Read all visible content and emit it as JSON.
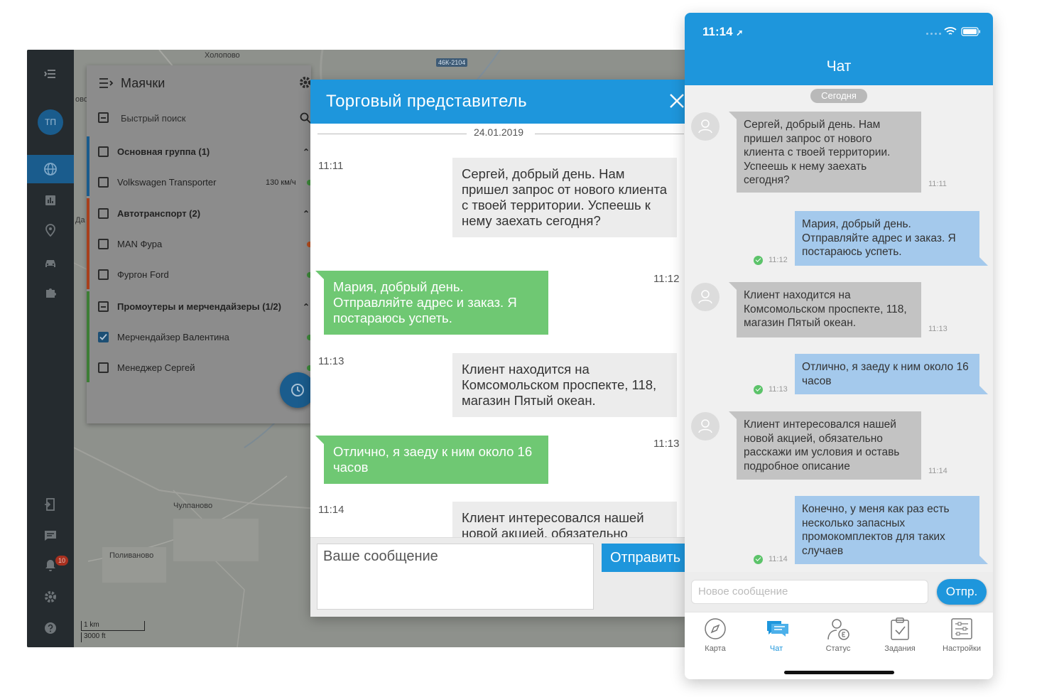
{
  "desktop": {
    "avatar_initials": "ТП",
    "notification_count": "10",
    "map": {
      "labels": [
        "Холопово",
        "Чулпаново",
        "Поливаново",
        "Да",
        "ово"
      ],
      "road_tag": "46К-2104",
      "scale_km": "1 km",
      "scale_ft": "3000 ft"
    },
    "beacons_panel": {
      "title": "Маячки",
      "search_placeholder": "Быстрый поиск",
      "rows": [
        {
          "label": "Основная группа (1)",
          "type": "group",
          "state": "unchecked"
        },
        {
          "label": "Volkswagen Transporter",
          "type": "item",
          "state": "unchecked",
          "speed": "130 км/ч",
          "status_color": "#3d8a3a"
        },
        {
          "label": "Автотранспорт (2)",
          "type": "group",
          "state": "unchecked"
        },
        {
          "label": "MAN Фура",
          "type": "item",
          "state": "unchecked",
          "status_color": "#b54e1f"
        },
        {
          "label": "Фургон Ford",
          "type": "item",
          "state": "unchecked",
          "status_color": "#3d8a3a"
        },
        {
          "label": "Промоутеры и мерчендайзеры (1/2)",
          "type": "group",
          "state": "partial"
        },
        {
          "label": "Мерчендайзер Валентина",
          "type": "item",
          "state": "checked",
          "status_color": "#3d8a3a"
        },
        {
          "label": "Менеджер Сергей",
          "type": "item",
          "state": "unchecked",
          "status_color": "#3d8a3a"
        }
      ]
    },
    "chat_window": {
      "title": "Торговый представитель",
      "date": "24.01.2019",
      "messages": [
        {
          "dir": "in",
          "time": "11:11",
          "text": "Сергей, добрый день. Нам пришел запрос от нового клиента с твоей территории. Успеешь к нему заехать сегодня?"
        },
        {
          "dir": "out",
          "time": "11:12",
          "text": "Мария, добрый день. Отправляйте адрес и заказ. Я постараюсь успеть."
        },
        {
          "dir": "in",
          "time": "11:13",
          "text": "Клиент находится на Комсомольском проспекте, 118, магазин Пятый океан."
        },
        {
          "dir": "out",
          "time": "11:13",
          "text": "Отлично, я заеду к ним около 16 часов"
        },
        {
          "dir": "in",
          "time": "11:14",
          "text": "Клиент интересовался нашей новой акцией, обязательно"
        }
      ],
      "input_placeholder": "Ваше сообщение",
      "send_label": "Отправить"
    }
  },
  "phone": {
    "status_time": "11:14",
    "title": "Чат",
    "day_label": "Сегодня",
    "messages": [
      {
        "dir": "in",
        "time": "11:11",
        "text": "Сергей, добрый день. Нам пришел запрос от нового клиента с твоей территории. Успеешь к нему заехать сегодня?"
      },
      {
        "dir": "out",
        "time": "11:12",
        "text": "Мария, добрый день. Отправляйте адрес и заказ. Я постараюсь успеть."
      },
      {
        "dir": "in",
        "time": "11:13",
        "text": "Клиент находится на Комсомольском проспекте, 118, магазин Пятый океан."
      },
      {
        "dir": "out",
        "time": "11:13",
        "text": "Отлично, я заеду к ним около 16 часов"
      },
      {
        "dir": "in",
        "time": "11:14",
        "text": "Клиент интересовался нашей новой акцией, обязательно расскажи им условия и оставь подробное описание"
      },
      {
        "dir": "out",
        "time": "11:14",
        "text": "Конечно, у меня как раз есть несколько запасных промокомплектов для таких случаев"
      }
    ],
    "input_placeholder": "Новое сообщение",
    "send_label": "Отпр.",
    "tabs": [
      {
        "label": "Карта",
        "icon": "compass-icon"
      },
      {
        "label": "Чат",
        "icon": "chat-icon",
        "active": true
      },
      {
        "label": "Статус",
        "icon": "user-status-icon"
      },
      {
        "label": "Задания",
        "icon": "clipboard-icon"
      },
      {
        "label": "Настройки",
        "icon": "sliders-icon"
      }
    ],
    "colors": {
      "accent": "#1e96dc",
      "out_bubble": "#a4c9ec",
      "in_bubble": "#c3c3c3"
    }
  }
}
